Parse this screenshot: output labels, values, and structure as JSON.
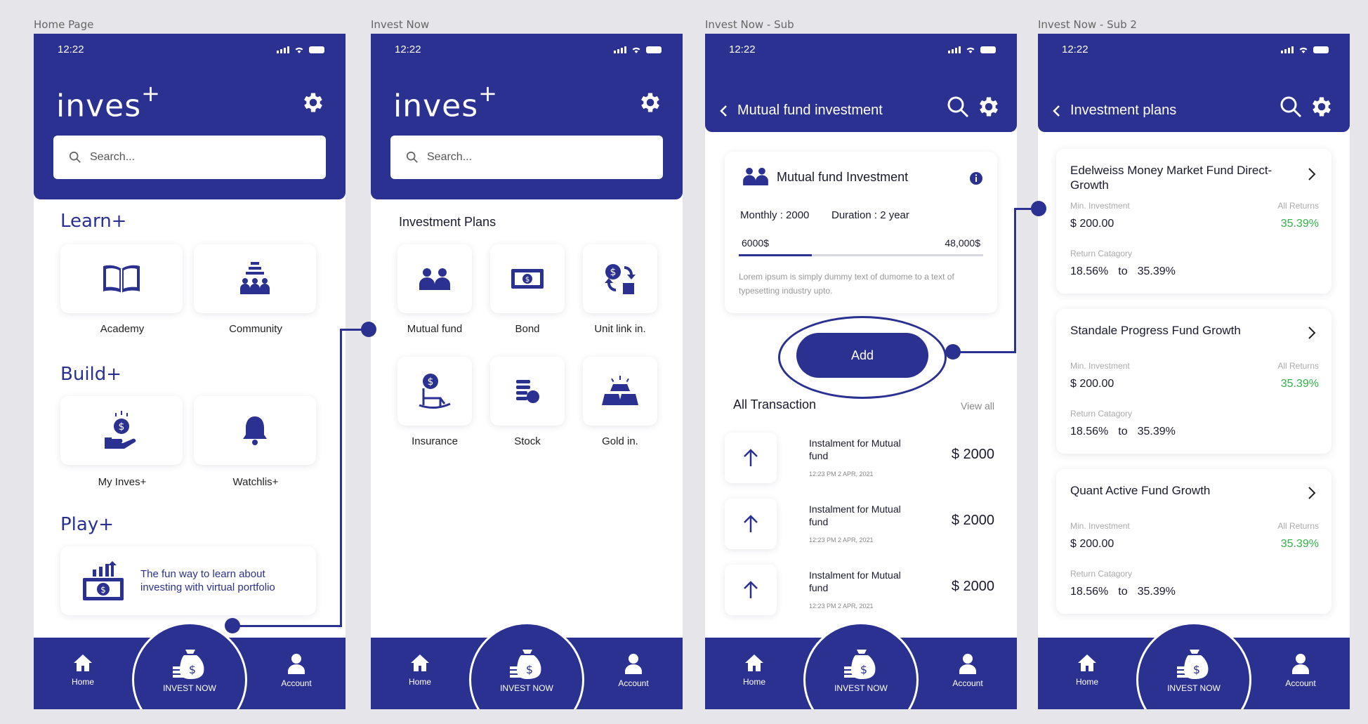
{
  "frames": {
    "home": "Home Page",
    "invest": "Invest Now",
    "sub": "Invest Now - Sub",
    "sub2": "Invest Now - Sub 2"
  },
  "status": {
    "time": "12:22"
  },
  "brand": {
    "name": "inves",
    "mark": "+"
  },
  "search": {
    "placeholder": "Search..."
  },
  "home": {
    "learn": {
      "title": "Learn+",
      "items": [
        "Academy",
        "Community"
      ]
    },
    "build": {
      "title": "Build+",
      "items": [
        "My Inves+",
        "Watchlis+"
      ]
    },
    "play": {
      "title": "Play+",
      "text": "The fun way to learn about investing with virtual portfolio"
    }
  },
  "invest": {
    "title": "Investment Plans",
    "plans": [
      "Mutual fund",
      "Bond",
      "Unit link in.",
      "Insurance",
      "Stock",
      "Gold in."
    ]
  },
  "sub": {
    "title": "Mutual fund investment",
    "card": {
      "title": "Mutual fund Investment",
      "monthly": "Monthly :  2000",
      "duration": "Duration : 2 year",
      "min": "6000$",
      "max": "48,000$",
      "progress": 0.3,
      "desc": "Lorem ipsum is simply dummy text of  dumome to a text of typesetting industry upto."
    },
    "add": "Add",
    "all_tx": "All Transaction",
    "view_all": "View all",
    "transactions": [
      {
        "title": "Instalment for Mutual fund",
        "time": "12:23 PM 2 APR, 2021",
        "amount": "$ 2000"
      },
      {
        "title": "Instalment for Mutual fund",
        "time": "12:23 PM 2 APR, 2021",
        "amount": "$ 2000"
      },
      {
        "title": "Instalment for Mutual fund",
        "time": "12:23 PM 2 APR, 2021",
        "amount": "$ 2000"
      }
    ]
  },
  "sub2": {
    "title": "Investment plans",
    "min_label": "Min. Investment",
    "returns_label": "All Returns",
    "category_label": "Return Catagory",
    "to": "to",
    "plans": [
      {
        "name": "Edelweiss Money Market Fund Direct-Growth",
        "min": "$ 200.00",
        "returns": "35.39%",
        "low": "18.56%",
        "high": "35.39%"
      },
      {
        "name": "Standale Progress Fund Growth",
        "min": "$ 200.00",
        "returns": "35.39%",
        "low": "18.56%",
        "high": "35.39%"
      },
      {
        "name": "Quant Active Fund Growth",
        "min": "$ 200.00",
        "returns": "35.39%",
        "low": "18.56%",
        "high": "35.39%"
      }
    ]
  },
  "nav": {
    "home": "Home",
    "invest": "INVEST NOW",
    "account": "Account"
  },
  "colors": {
    "primary": "#2b3191",
    "green": "#33b249",
    "background": "#e6e6ea"
  }
}
